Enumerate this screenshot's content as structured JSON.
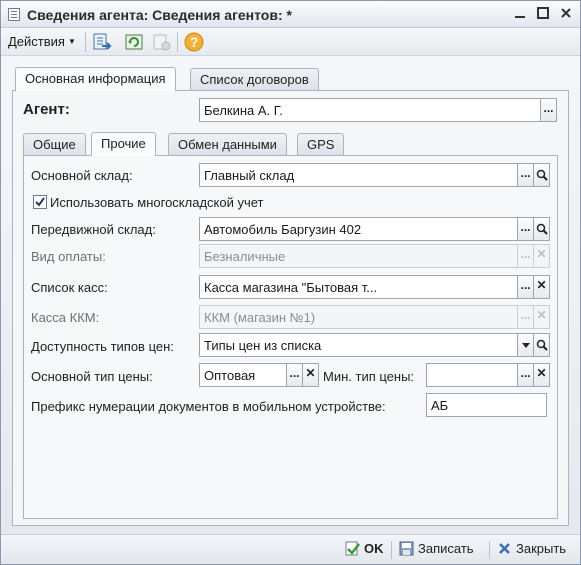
{
  "window": {
    "title": "Сведения агента: Сведения агентов: *"
  },
  "toolbar": {
    "actions_label": "Действия"
  },
  "outer_tabs": [
    {
      "label": "Основная информация"
    },
    {
      "label": "Список договоров"
    }
  ],
  "agent": {
    "label": "Агент:",
    "value": "Белкина А. Г."
  },
  "inner_tabs": [
    {
      "label": "Общие"
    },
    {
      "label": "Прочие"
    },
    {
      "label": "Обмен данными"
    },
    {
      "label": "GPS"
    }
  ],
  "form": {
    "main_warehouse": {
      "label": "Основной склад:",
      "value": "Главный склад"
    },
    "multi_warehouse": {
      "label": "Использовать многоскладской учет",
      "checked": true
    },
    "mobile_warehouse": {
      "label": "Передвижной склад:",
      "value": "Автомобиль Баргузин 402"
    },
    "payment_type": {
      "label": "Вид оплаты:",
      "value": "Безналичные"
    },
    "cash_list": {
      "label": "Список касс:",
      "value": "Касса магазина \"Бытовая т..."
    },
    "kkm": {
      "label": "Касса ККМ:",
      "value": "ККМ (магазин №1)"
    },
    "price_types_access": {
      "label": "Доступность типов цен:",
      "value": "Типы цен из списка"
    },
    "main_price_type": {
      "label": "Основной тип цены:",
      "value": "Оптовая"
    },
    "min_price_type": {
      "label": "Мин. тип цены:",
      "value": ""
    },
    "doc_prefix": {
      "label": "Префикс нумерации документов в мобильном устройстве:",
      "value": "АБ"
    }
  },
  "buttons": {
    "ok": "OK",
    "save": "Записать",
    "close": "Закрыть",
    "ellipsis": "...",
    "clear": "✕"
  },
  "colors": {
    "accent": "#2f6fb5",
    "ok_green": "#3a9a3a"
  }
}
